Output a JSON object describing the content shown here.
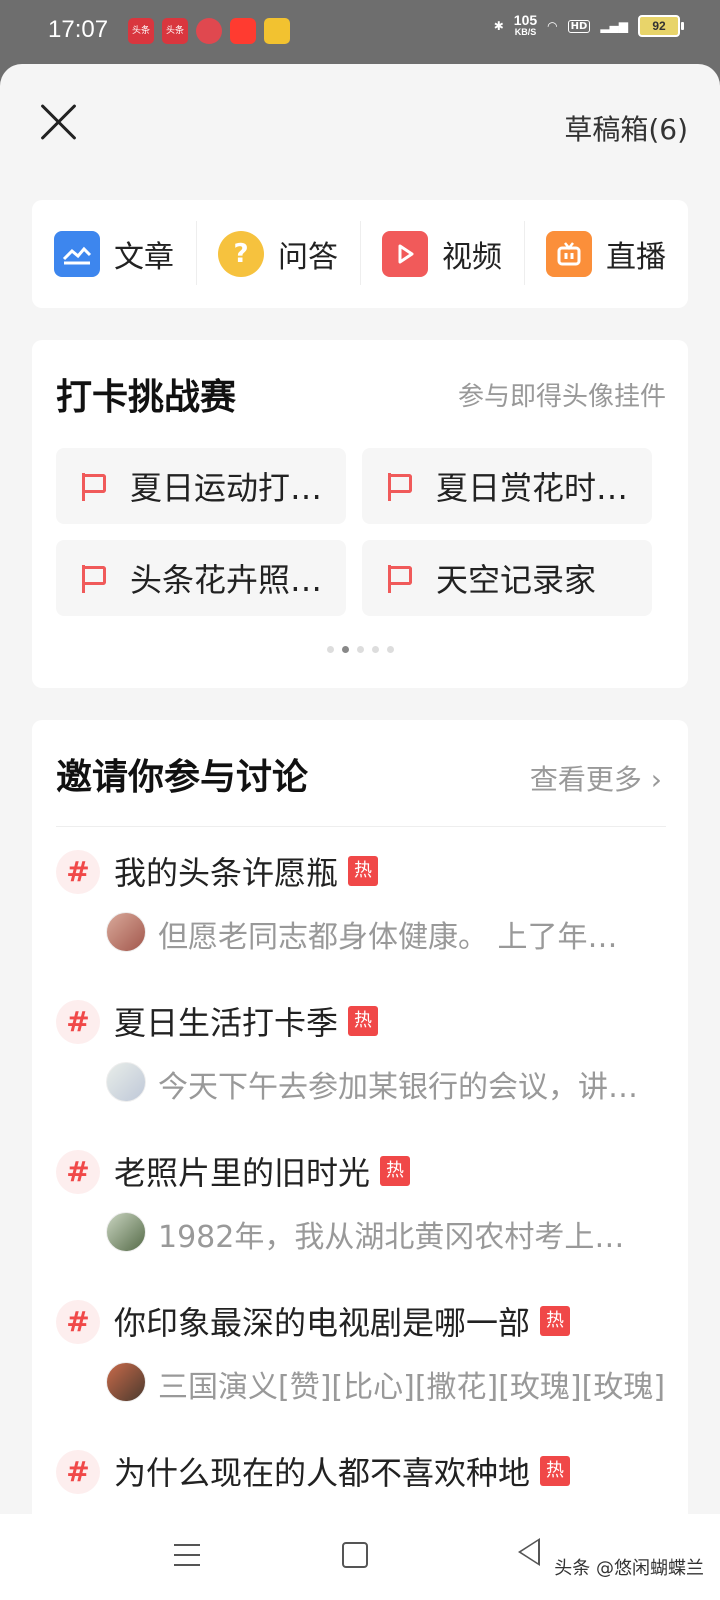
{
  "status_bar": {
    "time": "17:07",
    "apps": [
      "头条",
      "头条",
      "",
      "",
      ""
    ],
    "speed_value": "105",
    "speed_unit": "KB/S",
    "hd": "HD",
    "battery": "92"
  },
  "header": {
    "drafts_label": "草稿箱(6)"
  },
  "publish": {
    "items": [
      {
        "label": "文章",
        "icon": "article-icon"
      },
      {
        "label": "问答",
        "icon": "qa-icon"
      },
      {
        "label": "视频",
        "icon": "video-icon"
      },
      {
        "label": "直播",
        "icon": "live-icon"
      }
    ]
  },
  "checkin": {
    "title": "打卡挑战赛",
    "subtitle": "参与即得头像挂件",
    "items": [
      "夏日运动打…",
      "夏日赏花时…",
      "头条花卉照…",
      "天空记录家"
    ],
    "pager": {
      "count": 5,
      "active": 1
    }
  },
  "discuss": {
    "title": "邀请你参与讨论",
    "more": "查看更多",
    "hot_label": "热",
    "topics": [
      {
        "title": "我的头条许愿瓶",
        "preview": "但愿老同志都身体健康。 上了年…"
      },
      {
        "title": "夏日生活打卡季",
        "preview": "今天下午去参加某银行的会议，讲…"
      },
      {
        "title": "老照片里的旧时光",
        "preview": "1982年，我从湖北黄冈农村考上…"
      },
      {
        "title": "你印象最深的电视剧是哪一部",
        "preview": "三国演义[赞][比心][撒花][玫瑰][玫瑰]"
      },
      {
        "title": "为什么现在的人都不喜欢种地",
        "preview": ""
      }
    ]
  },
  "watermark": "头条 @悠闲蝴蝶兰"
}
